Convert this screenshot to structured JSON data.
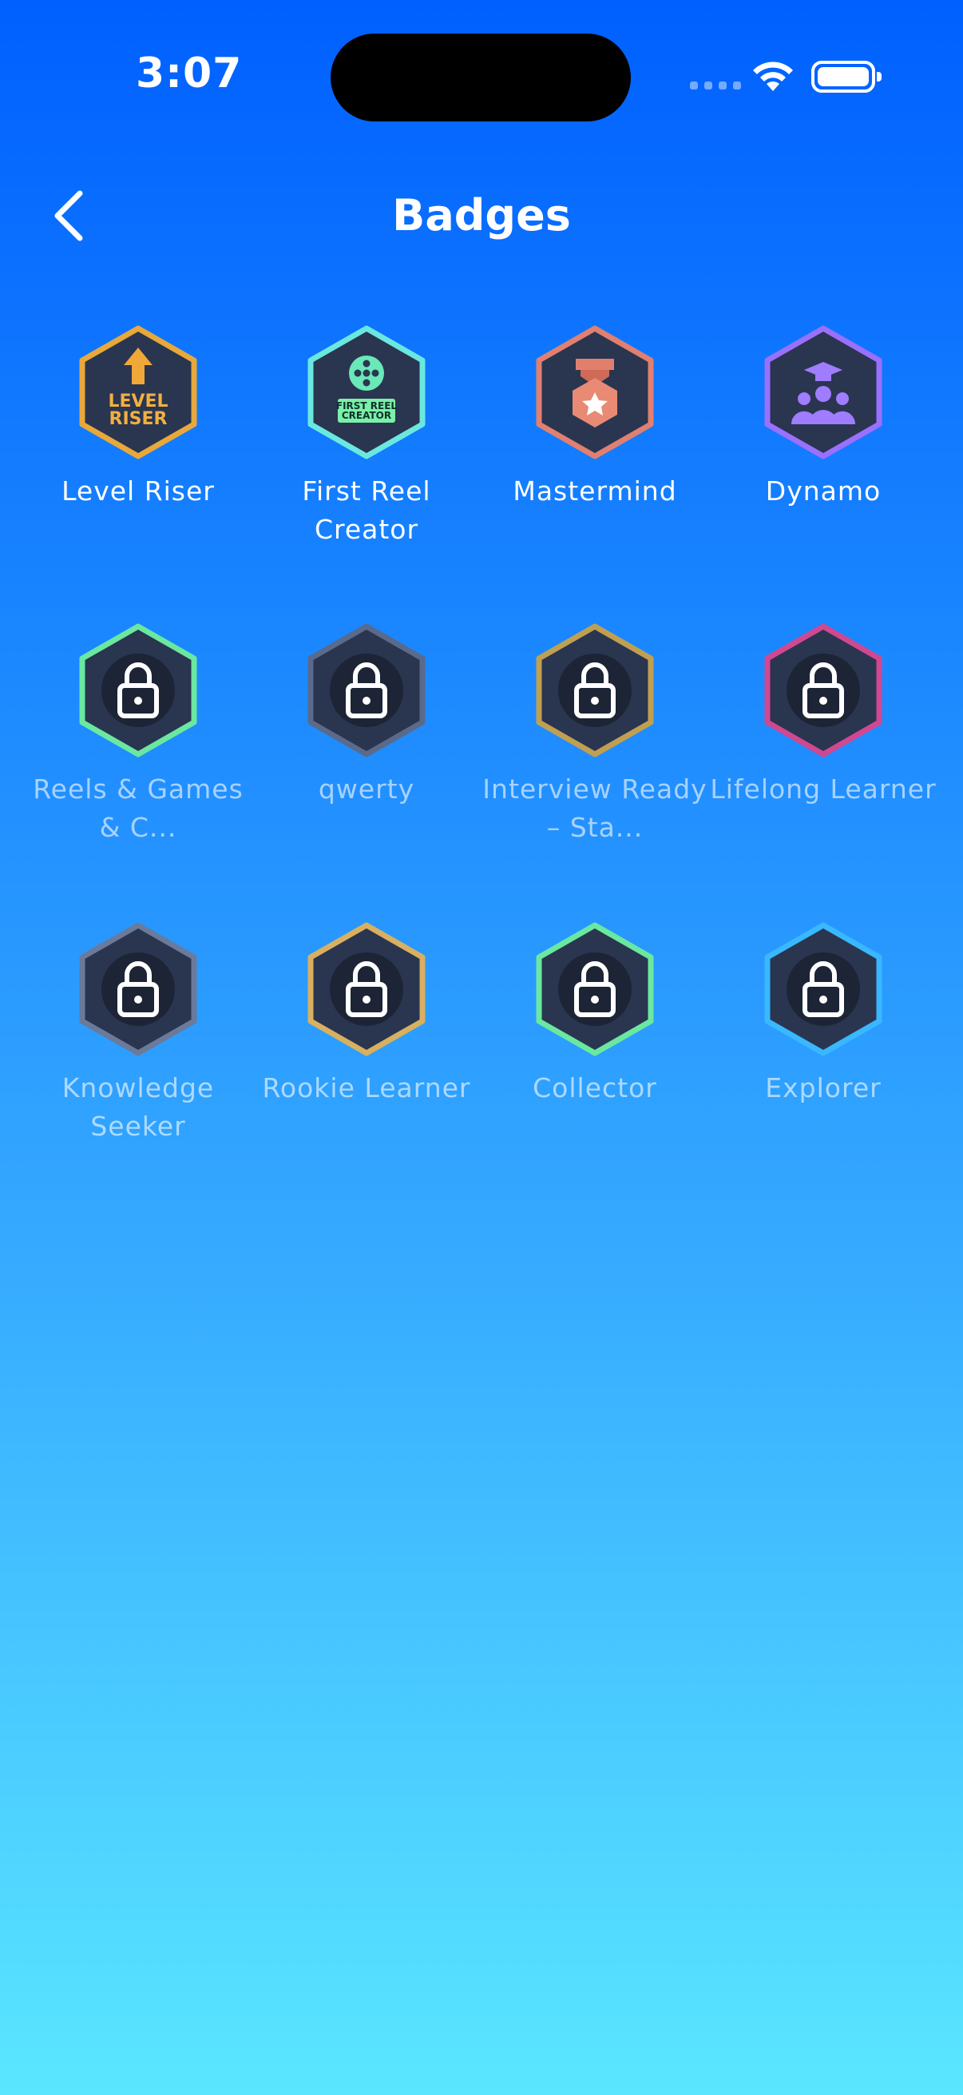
{
  "status_bar": {
    "time": "3:07"
  },
  "header": {
    "title": "Badges"
  },
  "colors": {
    "bg_top": "#0060ff",
    "bg_bottom": "#5ae6ff",
    "badge_fill": "#2a3550"
  },
  "badges": [
    {
      "label": "Level Riser",
      "locked": false,
      "icon": "arrow-up-icon",
      "text": [
        "LEVEL",
        "RISER"
      ],
      "border": "#e8a83a"
    },
    {
      "label": "First Reel Creator",
      "locked": false,
      "icon": "film-reel-icon",
      "text": [
        "FIRST REEL",
        "CREATOR"
      ],
      "border": "#6ae8e0"
    },
    {
      "label": "Mastermind",
      "locked": false,
      "icon": "medal-icon",
      "border": "#e08070"
    },
    {
      "label": "Dynamo",
      "locked": false,
      "icon": "graduation-group-icon",
      "border": "#9a70ff"
    },
    {
      "label": "Reels & Games & C...",
      "locked": true,
      "icon": "lock-icon",
      "border": "#6ae8a0"
    },
    {
      "label": "qwerty",
      "locked": true,
      "icon": "lock-icon",
      "border": "#5a6a8a"
    },
    {
      "label": "Interview Ready – Sta...",
      "locked": true,
      "icon": "lock-icon",
      "border": "#c0a050"
    },
    {
      "label": "Lifelong Learner",
      "locked": true,
      "icon": "lock-icon",
      "border": "#d04890"
    },
    {
      "label": "Knowledge Seeker",
      "locked": true,
      "icon": "lock-icon",
      "border": "#6a7a9a"
    },
    {
      "label": "Rookie Learner",
      "locked": true,
      "icon": "lock-icon",
      "border": "#d8b060"
    },
    {
      "label": "Collector",
      "locked": true,
      "icon": "lock-icon",
      "border": "#6ae8a0"
    },
    {
      "label": "Explorer",
      "locked": true,
      "icon": "lock-icon",
      "border": "#3ab8ff"
    }
  ]
}
